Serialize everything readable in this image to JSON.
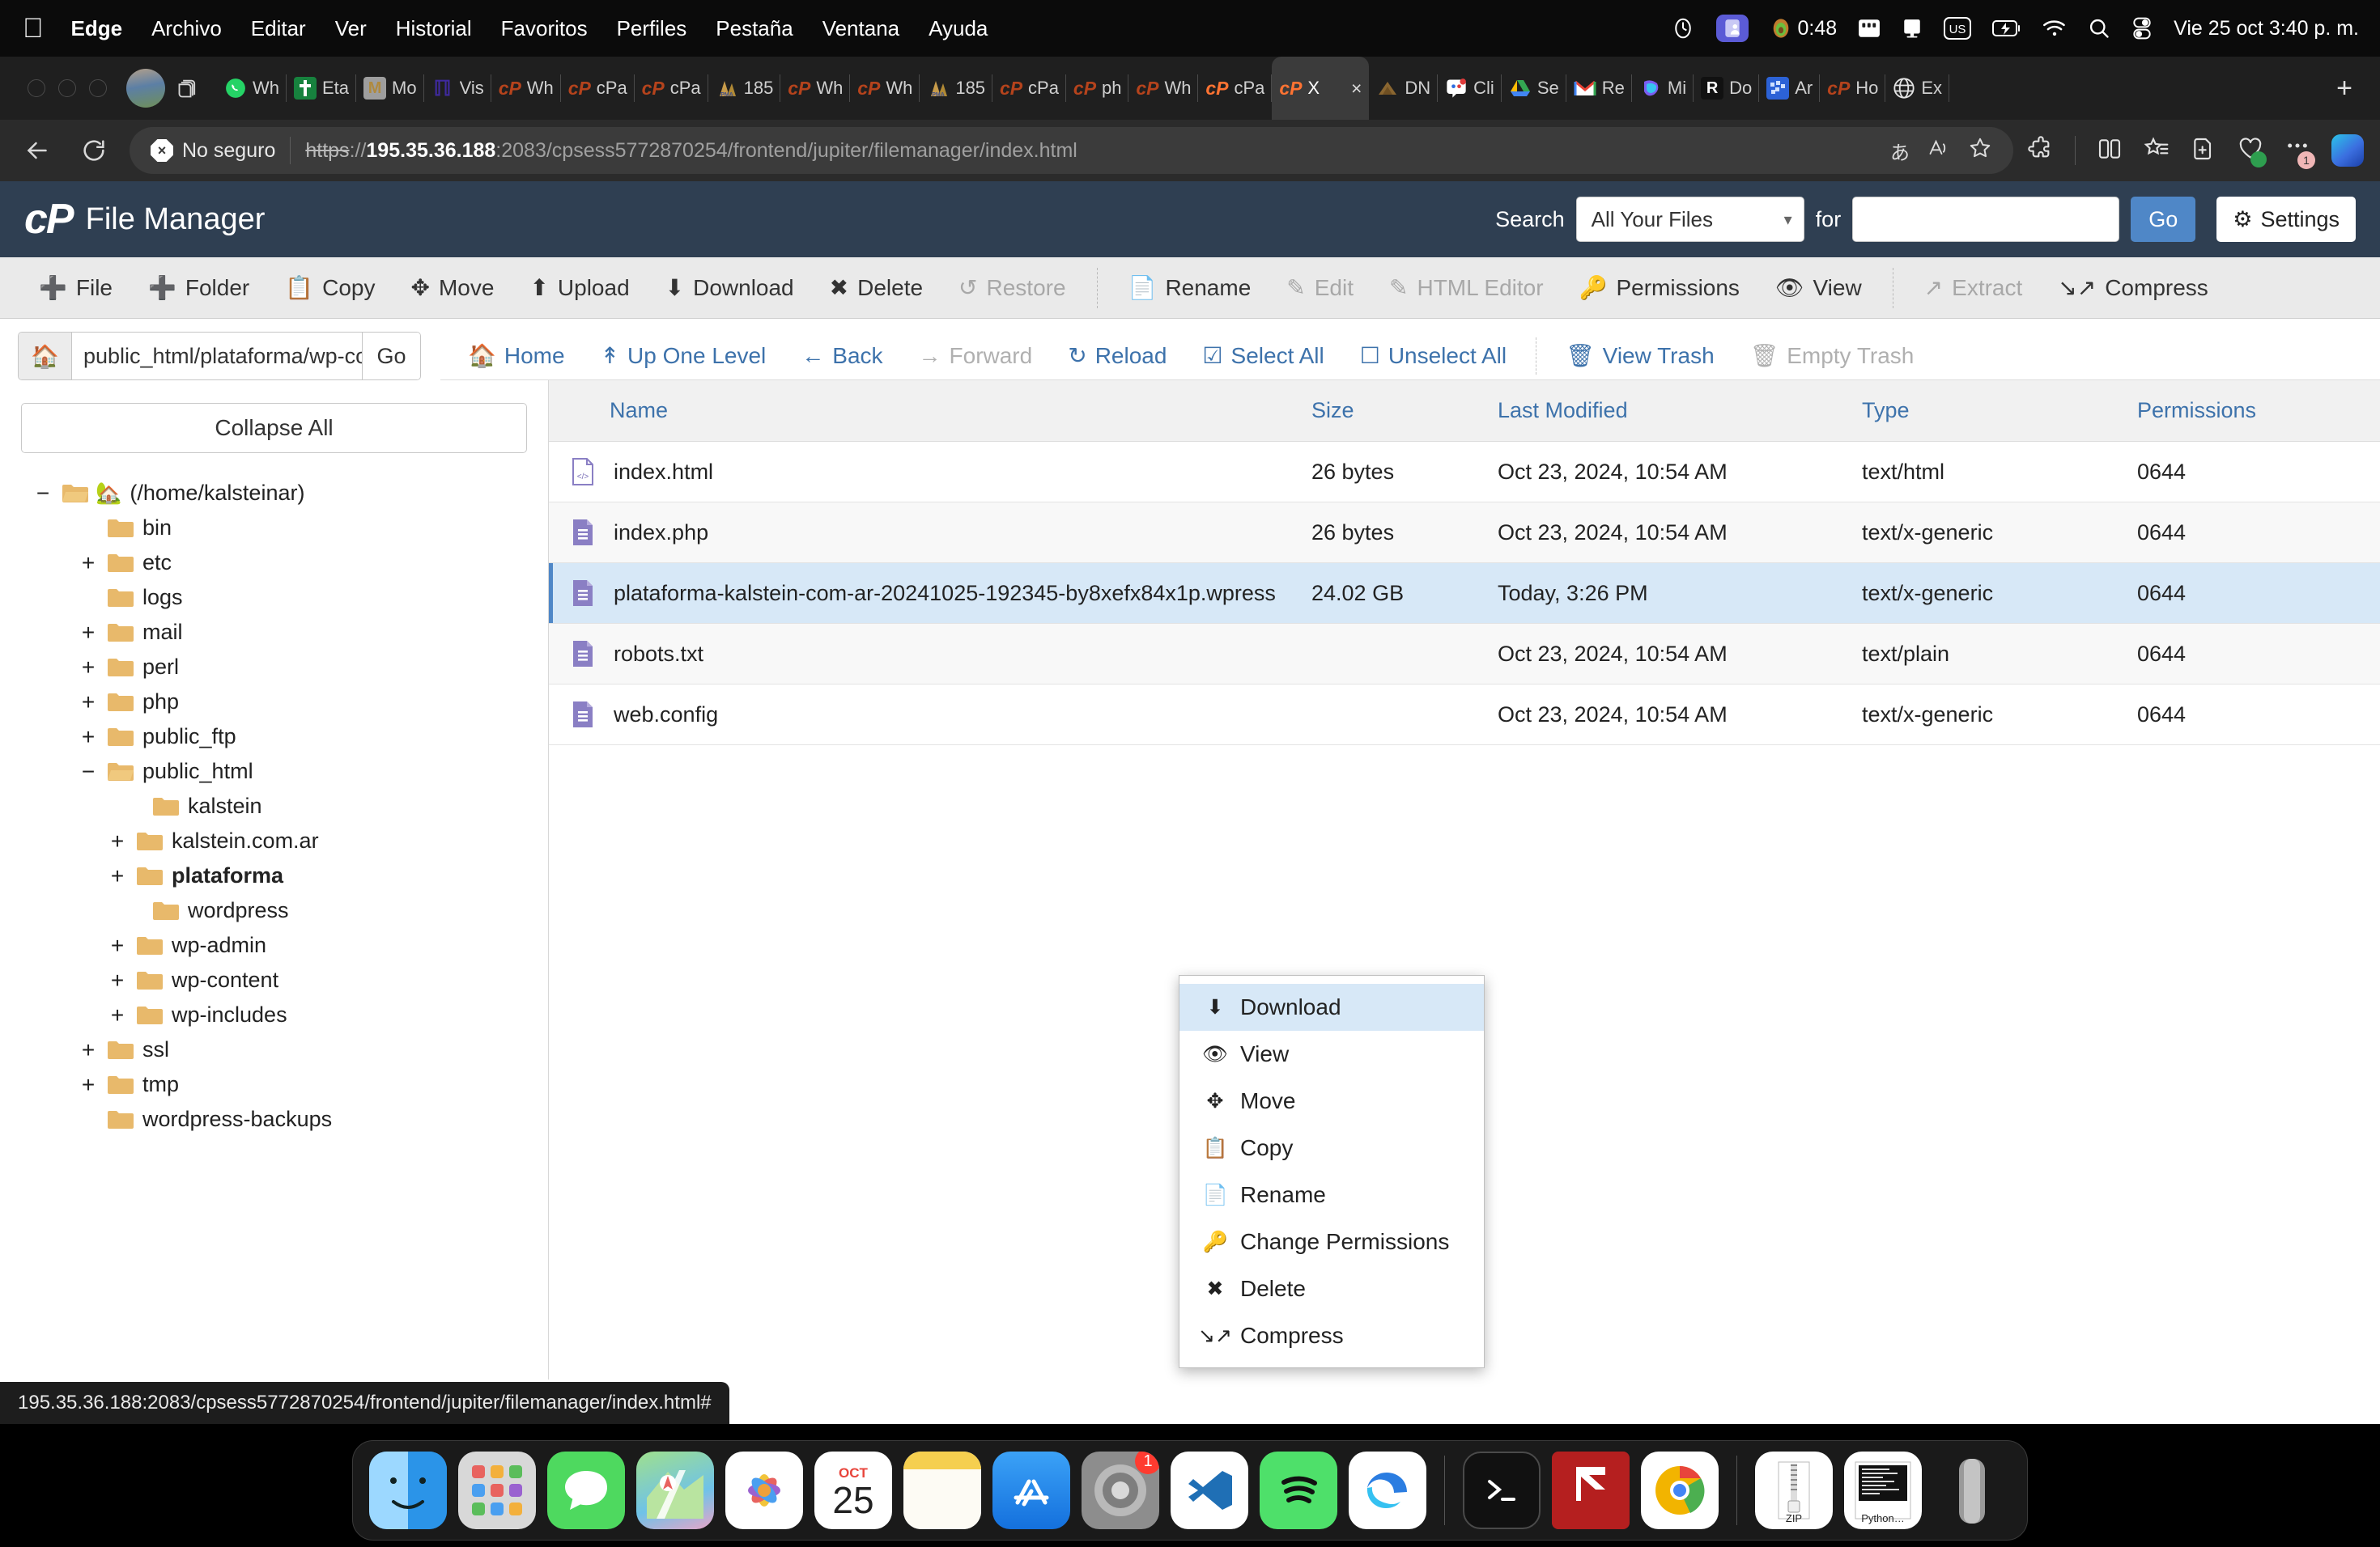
{
  "menubar": {
    "apple": "apple-logo",
    "items": [
      {
        "label": "Edge",
        "bold": true
      },
      {
        "label": "Archivo",
        "bold": false
      },
      {
        "label": "Editar",
        "bold": false
      },
      {
        "label": "Ver",
        "bold": false
      },
      {
        "label": "Historial",
        "bold": false
      },
      {
        "label": "Favoritos",
        "bold": false
      },
      {
        "label": "Perfiles",
        "bold": false
      },
      {
        "label": "Pestaña",
        "bold": false
      },
      {
        "label": "Ventana",
        "bold": false
      },
      {
        "label": "Ayuda",
        "bold": false
      }
    ],
    "timer": "0:48",
    "keyboard_layout": "US",
    "clock": "Vie 25 oct 3:40 p. m."
  },
  "browser": {
    "tabs": [
      {
        "label": "Wh",
        "favicon": "whatsapp-icon"
      },
      {
        "label": "Eta",
        "favicon": "etapa-icon"
      },
      {
        "label": "Mo",
        "favicon": "medium-icon"
      },
      {
        "label": "Vis",
        "favicon": "hubspot-icon"
      },
      {
        "label": "Wh",
        "favicon": "cpanel-icon"
      },
      {
        "label": "cPa",
        "favicon": "cpanel-icon"
      },
      {
        "label": "cPa",
        "favicon": "cpanel-icon"
      },
      {
        "label": "185",
        "favicon": "pma-icon"
      },
      {
        "label": "Wh",
        "favicon": "cpanel-icon"
      },
      {
        "label": "Wh",
        "favicon": "cpanel-icon"
      },
      {
        "label": "185",
        "favicon": "pma-icon"
      },
      {
        "label": "cPa",
        "favicon": "cpanel-icon"
      },
      {
        "label": "ph",
        "favicon": "cpanel-icon"
      },
      {
        "label": "Wh",
        "favicon": "cpanel-icon"
      },
      {
        "label": "cPa",
        "favicon": "cpanel-icon"
      },
      {
        "label": "X",
        "favicon": "cpanel-icon",
        "active": true
      },
      {
        "label": "DN",
        "favicon": "dns-icon"
      },
      {
        "label": "Cli",
        "favicon": "chat-icon"
      },
      {
        "label": "Se",
        "favicon": "drive-icon"
      },
      {
        "label": "Re",
        "favicon": "gmail-icon"
      },
      {
        "label": "Mi",
        "favicon": "copilot-icon"
      },
      {
        "label": "Do",
        "favicon": "r-icon"
      },
      {
        "label": "Ar",
        "favicon": "dropbox-icon"
      },
      {
        "label": "Ho",
        "favicon": "cpanel-icon"
      },
      {
        "label": "Ex",
        "favicon": "globe-icon"
      }
    ],
    "new_tab_label": "+",
    "security_label": "No seguro",
    "security_badge": "×",
    "url": {
      "scheme": "https",
      "separator": "://",
      "host": "195.35.36.188",
      "rest": ":2083/cpsess5772870254/frontend/jupiter/filemanager/index.html"
    },
    "toolbar_icons": [
      "translate-icon",
      "read-aloud-icon",
      "favorite-star-icon",
      "extensions-icon",
      "split-screen-icon",
      "collections-icon",
      "add-to-favorites-icon",
      "browser-essentials-icon",
      "settings-more-icon",
      "copilot-icon"
    ],
    "share_badge_count": "1"
  },
  "cpanel": {
    "app_title": "File Manager",
    "logo": "cP",
    "search": {
      "label": "Search",
      "scope_value": "All Your Files",
      "for_label": "for",
      "query_value": "",
      "query_placeholder": "",
      "go_label": "Go",
      "settings_label": "Settings"
    },
    "toolbar": [
      {
        "label": "File",
        "icon": "plus-icon",
        "disabled": false
      },
      {
        "label": "Folder",
        "icon": "plus-icon",
        "disabled": false
      },
      {
        "label": "Copy",
        "icon": "copy-icon",
        "disabled": false
      },
      {
        "label": "Move",
        "icon": "move-icon",
        "disabled": false
      },
      {
        "label": "Upload",
        "icon": "upload-icon",
        "disabled": false
      },
      {
        "label": "Download",
        "icon": "download-icon",
        "disabled": false
      },
      {
        "label": "Delete",
        "icon": "delete-x-icon",
        "disabled": false
      },
      {
        "label": "Restore",
        "icon": "restore-icon",
        "disabled": true
      },
      {
        "divider": true
      },
      {
        "label": "Rename",
        "icon": "rename-file-icon",
        "disabled": false
      },
      {
        "label": "Edit",
        "icon": "pencil-icon",
        "disabled": true
      },
      {
        "label": "HTML Editor",
        "icon": "html-editor-icon",
        "disabled": true
      },
      {
        "label": "Permissions",
        "icon": "key-icon",
        "disabled": false
      },
      {
        "label": "View",
        "icon": "eye-icon",
        "disabled": false
      },
      {
        "divider": true
      },
      {
        "label": "Extract",
        "icon": "extract-icon",
        "disabled": true
      },
      {
        "label": "Compress",
        "icon": "compress-icon",
        "disabled": false
      }
    ],
    "path": {
      "value": "public_html/plataforma/wp-co",
      "go_label": "Go",
      "home_icon": "home-icon"
    },
    "nav": [
      {
        "label": "Home",
        "icon": "home-icon",
        "disabled": false
      },
      {
        "label": "Up One Level",
        "icon": "up-arrow-icon",
        "disabled": false
      },
      {
        "label": "Back",
        "icon": "left-arrow-icon",
        "disabled": false
      },
      {
        "label": "Forward",
        "icon": "right-arrow-icon",
        "disabled": true
      },
      {
        "label": "Reload",
        "icon": "reload-icon",
        "disabled": false
      },
      {
        "label": "Select All",
        "icon": "checkbox-checked-icon",
        "disabled": false
      },
      {
        "label": "Unselect All",
        "icon": "checkbox-empty-icon",
        "disabled": false
      },
      {
        "divider": true
      },
      {
        "label": "View Trash",
        "icon": "trash-icon",
        "disabled": false
      },
      {
        "label": "Empty Trash",
        "icon": "trash-icon",
        "disabled": true
      }
    ],
    "collapse_all_label": "Collapse All",
    "tree": [
      {
        "label": "(/home/kalsteinar)",
        "toggle": "−",
        "indent": 0,
        "home": true,
        "open": true
      },
      {
        "label": "bin",
        "toggle": "",
        "indent": 1
      },
      {
        "label": "etc",
        "toggle": "+",
        "indent": 1
      },
      {
        "label": "logs",
        "toggle": "",
        "indent": 1
      },
      {
        "label": "mail",
        "toggle": "+",
        "indent": 1
      },
      {
        "label": "perl",
        "toggle": "+",
        "indent": 1
      },
      {
        "label": "php",
        "toggle": "+",
        "indent": 1
      },
      {
        "label": "public_ftp",
        "toggle": "+",
        "indent": 1
      },
      {
        "label": "public_html",
        "toggle": "−",
        "indent": 1,
        "open": true
      },
      {
        "label": "kalstein",
        "toggle": "",
        "indent": 2
      },
      {
        "label": "kalstein.com.ar",
        "toggle": "+",
        "indent": 2
      },
      {
        "label": "plataforma",
        "toggle": "+",
        "indent": 2,
        "bold": true
      },
      {
        "label": "wordpress",
        "toggle": "",
        "indent": 2
      },
      {
        "label": "wp-admin",
        "toggle": "+",
        "indent": 2
      },
      {
        "label": "wp-content",
        "toggle": "+",
        "indent": 2
      },
      {
        "label": "wp-includes",
        "toggle": "+",
        "indent": 2
      },
      {
        "label": "ssl",
        "toggle": "+",
        "indent": 1
      },
      {
        "label": "tmp",
        "toggle": "+",
        "indent": 1
      },
      {
        "label": "wordpress-backups",
        "toggle": "",
        "indent": 1
      }
    ],
    "table": {
      "columns": [
        "Name",
        "Size",
        "Last Modified",
        "Type",
        "Permissions"
      ],
      "rows": [
        {
          "name": "index.html",
          "size": "26 bytes",
          "modified": "Oct 23, 2024, 10:54 AM",
          "type": "text/html",
          "permissions": "0644",
          "icon": "html-file-icon",
          "selected": false
        },
        {
          "name": "index.php",
          "size": "26 bytes",
          "modified": "Oct 23, 2024, 10:54 AM",
          "type": "text/x-generic",
          "permissions": "0644",
          "icon": "text-file-icon",
          "selected": false
        },
        {
          "name": "plataforma-kalstein-com-ar-20241025-192345-by8xefx84x1p.wpress",
          "size": "24.02 GB",
          "modified": "Today, 3:26 PM",
          "type": "text/x-generic",
          "permissions": "0644",
          "icon": "text-file-icon",
          "selected": true
        },
        {
          "name": "robots.txt",
          "size": "",
          "modified": "Oct 23, 2024, 10:54 AM",
          "type": "text/plain",
          "permissions": "0644",
          "icon": "text-file-icon",
          "selected": false
        },
        {
          "name": "web.config",
          "size": "",
          "modified": "Oct 23, 2024, 10:54 AM",
          "type": "text/x-generic",
          "permissions": "0644",
          "icon": "text-file-icon",
          "selected": false
        }
      ]
    },
    "context_menu": [
      {
        "label": "Download",
        "icon": "download-icon",
        "highlighted": true
      },
      {
        "label": "View",
        "icon": "eye-icon",
        "highlighted": false
      },
      {
        "label": "Move",
        "icon": "move-icon",
        "highlighted": false
      },
      {
        "label": "Copy",
        "icon": "copy-icon",
        "highlighted": false
      },
      {
        "label": "Rename",
        "icon": "rename-file-icon",
        "highlighted": false
      },
      {
        "label": "Change Permissions",
        "icon": "key-icon",
        "highlighted": false
      },
      {
        "label": "Delete",
        "icon": "delete-x-icon",
        "highlighted": false
      },
      {
        "label": "Compress",
        "icon": "compress-icon",
        "highlighted": false
      }
    ],
    "status_url": "195.35.36.188:2083/cpsess5772870254/frontend/jupiter/filemanager/index.html#"
  },
  "dock": {
    "items": [
      {
        "name": "finder-icon",
        "running": true
      },
      {
        "name": "launchpad-icon",
        "running": false
      },
      {
        "name": "messages-icon",
        "running": false
      },
      {
        "name": "maps-icon",
        "running": false
      },
      {
        "name": "photos-icon",
        "running": true
      },
      {
        "name": "calendar-icon",
        "running": true,
        "month": "OCT",
        "day": "25"
      },
      {
        "name": "notes-icon",
        "running": false
      },
      {
        "name": "app-store-icon",
        "running": false
      },
      {
        "name": "system-settings-icon",
        "running": true,
        "badge": "1"
      },
      {
        "name": "vscode-icon",
        "running": true
      },
      {
        "name": "spotify-icon",
        "running": false
      },
      {
        "name": "edge-icon",
        "running": true
      },
      {
        "divider": true
      },
      {
        "name": "terminal-icon",
        "running": true
      },
      {
        "name": "filezilla-icon",
        "running": true
      },
      {
        "name": "chrome-icon",
        "running": true
      },
      {
        "divider": true
      },
      {
        "name": "zip-file-icon",
        "label": "ZIP"
      },
      {
        "name": "python-file-icon",
        "label": "Python…"
      },
      {
        "name": "trash-icon",
        "running": false
      }
    ]
  }
}
